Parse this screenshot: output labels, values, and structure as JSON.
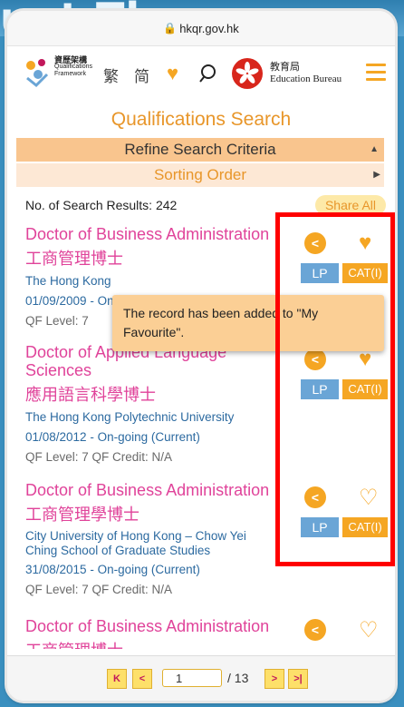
{
  "banner": {
    "text": "uet Theoscu"
  },
  "browser": {
    "url": "hkqr.gov.hk"
  },
  "header": {
    "qf_cn": "資歷架構",
    "qf_en1": "Qualifications",
    "qf_en2": "Framework",
    "lang_trad": "繁",
    "lang_simp": "简",
    "edb_cn": "教育局",
    "edb_en": "Education Bureau"
  },
  "page": {
    "title": "Qualifications Search",
    "refine": "Refine Search Criteria",
    "sorting": "Sorting Order",
    "count": "No. of Search Results: 242",
    "share_all": "Share All"
  },
  "records": [
    {
      "title": "Doctor of Business Administration",
      "cn": "工商管理博士",
      "provider": "The Hong Kong",
      "date": "01/09/2009 - On-going  (Current)",
      "level": "QF Level: 7"
    },
    {
      "title_line1": "Doctor of Applied Language",
      "title_line2": "Sciences",
      "cn": "應用語言科學博士",
      "provider": "The Hong Kong Polytechnic University",
      "date": "01/08/2012 - On-going  (Current)",
      "level": "QF Level: 7   QF Credit: N/A"
    },
    {
      "title": "Doctor of Business Administration",
      "cn": "工商管理學博士",
      "provider_line1": "City University of Hong Kong – Chow Yei",
      "provider_line2": "Ching School of Graduate Studies",
      "date": "31/08/2015 - On-going  (Current)",
      "level": "QF Level: 7   QF Credit: N/A"
    },
    {
      "title": "Doctor of Business Administration",
      "cn": "工商管理博士"
    }
  ],
  "actions": {
    "lp": "LP",
    "cat": "CAT(I)"
  },
  "tooltip": {
    "line1": "The record has been added to \"My",
    "line2": "Favourite\"."
  },
  "pager": {
    "first": "K",
    "prev": "<",
    "current": "1",
    "total": "/ 13",
    "next": ">",
    "last": ">|"
  },
  "colors": {
    "accent": "#f5a623",
    "title_pink": "#e0439a",
    "highlight": "#ff0000"
  }
}
